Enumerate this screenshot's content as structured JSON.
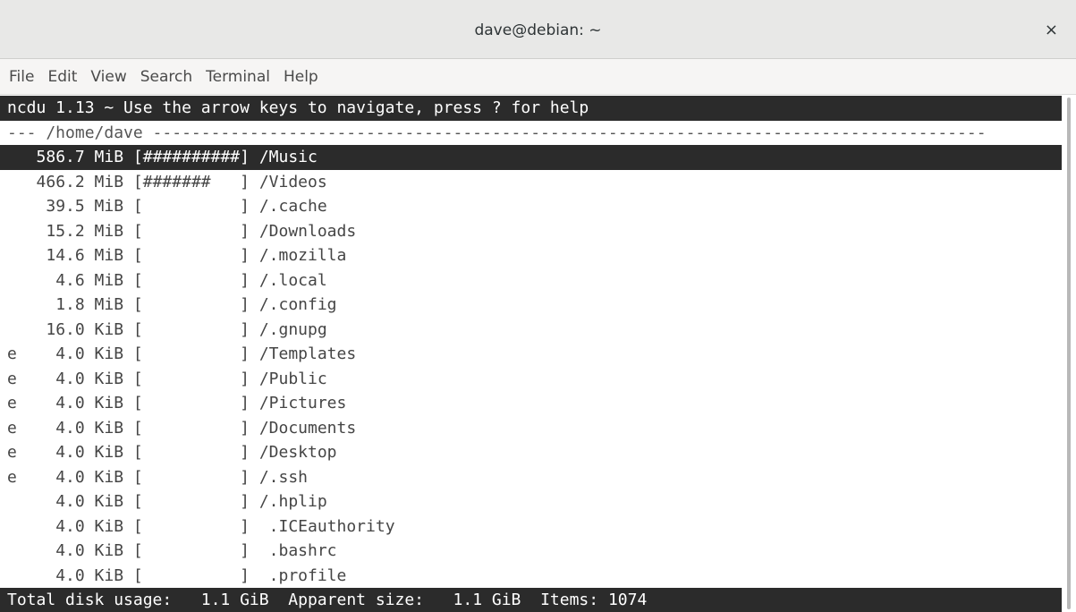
{
  "window": {
    "title": "dave@debian: ~",
    "close_symbol": "×"
  },
  "menu": [
    "File",
    "Edit",
    "View",
    "Search",
    "Terminal",
    "Help"
  ],
  "ncdu": {
    "header": "ncdu 1.13 ~ Use the arrow keys to navigate, press ? for help",
    "dir_line": "--- /home/dave --------------------------------------------------------------------------------------",
    "entries": [
      {
        "flag": " ",
        "size": "586.7 MiB",
        "bar": "[##########]",
        "name": "/Music",
        "selected": true
      },
      {
        "flag": " ",
        "size": "466.2 MiB",
        "bar": "[#######   ]",
        "name": "/Videos"
      },
      {
        "flag": " ",
        "size": " 39.5 MiB",
        "bar": "[          ]",
        "name": "/.cache"
      },
      {
        "flag": " ",
        "size": " 15.2 MiB",
        "bar": "[          ]",
        "name": "/Downloads"
      },
      {
        "flag": " ",
        "size": " 14.6 MiB",
        "bar": "[          ]",
        "name": "/.mozilla"
      },
      {
        "flag": " ",
        "size": "  4.6 MiB",
        "bar": "[          ]",
        "name": "/.local"
      },
      {
        "flag": " ",
        "size": "  1.8 MiB",
        "bar": "[          ]",
        "name": "/.config"
      },
      {
        "flag": " ",
        "size": " 16.0 KiB",
        "bar": "[          ]",
        "name": "/.gnupg"
      },
      {
        "flag": "e",
        "size": "  4.0 KiB",
        "bar": "[          ]",
        "name": "/Templates"
      },
      {
        "flag": "e",
        "size": "  4.0 KiB",
        "bar": "[          ]",
        "name": "/Public"
      },
      {
        "flag": "e",
        "size": "  4.0 KiB",
        "bar": "[          ]",
        "name": "/Pictures"
      },
      {
        "flag": "e",
        "size": "  4.0 KiB",
        "bar": "[          ]",
        "name": "/Documents"
      },
      {
        "flag": "e",
        "size": "  4.0 KiB",
        "bar": "[          ]",
        "name": "/Desktop"
      },
      {
        "flag": "e",
        "size": "  4.0 KiB",
        "bar": "[          ]",
        "name": "/.ssh"
      },
      {
        "flag": " ",
        "size": "  4.0 KiB",
        "bar": "[          ]",
        "name": "/.hplip"
      },
      {
        "flag": " ",
        "size": "  4.0 KiB",
        "bar": "[          ]",
        "name": " .ICEauthority"
      },
      {
        "flag": " ",
        "size": "  4.0 KiB",
        "bar": "[          ]",
        "name": " .bashrc"
      },
      {
        "flag": " ",
        "size": "  4.0 KiB",
        "bar": "[          ]",
        "name": " .profile"
      }
    ],
    "status": {
      "total_label": "Total disk usage:",
      "total_value": "1.1 GiB",
      "apparent_label": "Apparent size:",
      "apparent_value": "1.1 GiB",
      "items_label": "Items:",
      "items_value": "1074"
    }
  }
}
